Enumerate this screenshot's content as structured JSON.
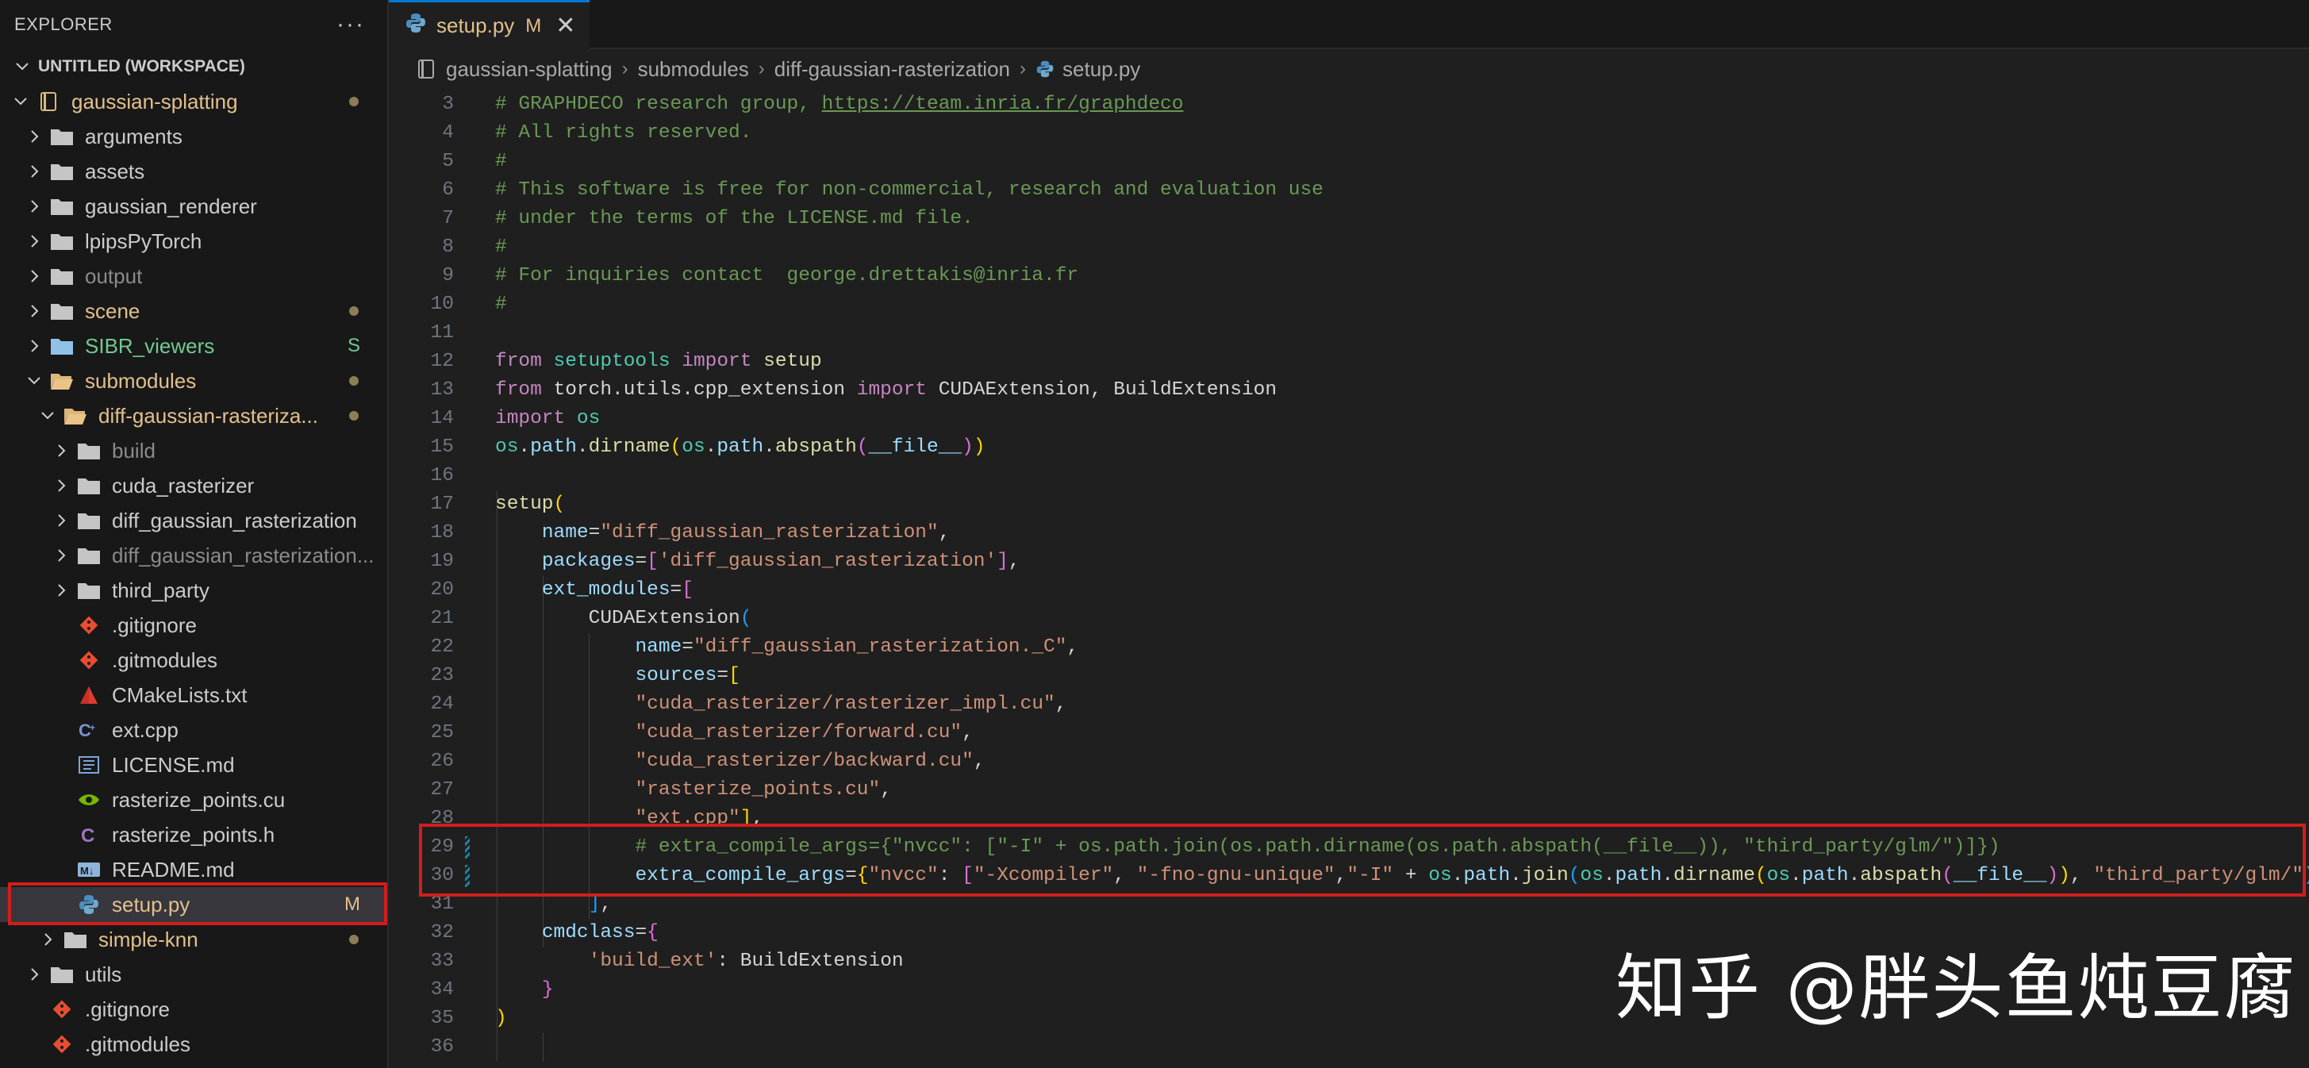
{
  "explorer": {
    "title": "EXPLORER",
    "more_label": "···",
    "workspace": "UNTITLED (WORKSPACE)",
    "items": [
      {
        "label": "gaussian-splatting",
        "type": "repo",
        "open": true,
        "indent": 0,
        "badge": "dot",
        "status": "mod"
      },
      {
        "label": "arguments",
        "type": "folder",
        "open": false,
        "indent": 1
      },
      {
        "label": "assets",
        "type": "folder",
        "open": false,
        "indent": 1
      },
      {
        "label": "gaussian_renderer",
        "type": "folder",
        "open": false,
        "indent": 1
      },
      {
        "label": "lpipsPyTorch",
        "type": "folder",
        "open": false,
        "indent": 1
      },
      {
        "label": "output",
        "type": "folder",
        "open": false,
        "indent": 1,
        "status": "dim"
      },
      {
        "label": "scene",
        "type": "folder",
        "open": false,
        "indent": 1,
        "badge": "dot",
        "status": "mod"
      },
      {
        "label": "SIBR_viewers",
        "type": "folder-blue",
        "open": false,
        "indent": 1,
        "badge": "S",
        "status": "untracked"
      },
      {
        "label": "submodules",
        "type": "folder",
        "open": true,
        "indent": 1,
        "badge": "dot",
        "status": "mod"
      },
      {
        "label": "diff-gaussian-rasteriza...",
        "type": "folder",
        "open": true,
        "indent": 2,
        "badge": "dot",
        "status": "mod"
      },
      {
        "label": "build",
        "type": "folder",
        "open": false,
        "indent": 3,
        "status": "dim"
      },
      {
        "label": "cuda_rasterizer",
        "type": "folder",
        "open": false,
        "indent": 3
      },
      {
        "label": "diff_gaussian_rasterization",
        "type": "folder",
        "open": false,
        "indent": 3
      },
      {
        "label": "diff_gaussian_rasterization...",
        "type": "folder",
        "open": false,
        "indent": 3,
        "status": "dim"
      },
      {
        "label": "third_party",
        "type": "folder",
        "open": false,
        "indent": 3
      },
      {
        "label": ".gitignore",
        "type": "git",
        "indent": 3,
        "nochev": true
      },
      {
        "label": ".gitmodules",
        "type": "git",
        "indent": 3,
        "nochev": true
      },
      {
        "label": "CMakeLists.txt",
        "type": "cmake",
        "indent": 3,
        "nochev": true
      },
      {
        "label": "ext.cpp",
        "type": "cpp",
        "indent": 3,
        "nochev": true
      },
      {
        "label": "LICENSE.md",
        "type": "md",
        "indent": 3,
        "nochev": true
      },
      {
        "label": "rasterize_points.cu",
        "type": "cuda",
        "indent": 3,
        "nochev": true
      },
      {
        "label": "rasterize_points.h",
        "type": "c",
        "indent": 3,
        "nochev": true
      },
      {
        "label": "README.md",
        "type": "readme",
        "indent": 3,
        "nochev": true
      },
      {
        "label": "setup.py",
        "type": "python",
        "indent": 3,
        "nochev": true,
        "badge": "M",
        "status": "mod",
        "selected": true
      },
      {
        "label": "simple-knn",
        "type": "folder",
        "open": false,
        "indent": 2,
        "badge": "dot",
        "status": "mod"
      },
      {
        "label": "utils",
        "type": "folder",
        "open": false,
        "indent": 1
      },
      {
        "label": ".gitignore",
        "type": "git",
        "indent": 1,
        "nochev": true
      },
      {
        "label": ".gitmodules",
        "type": "git",
        "indent": 1,
        "nochev": true
      }
    ]
  },
  "tab": {
    "title": "setup.py",
    "status": "M",
    "close": "✕"
  },
  "breadcrumb": [
    "gaussian-splatting",
    "submodules",
    "diff-gaussian-rasterization",
    "setup.py"
  ],
  "code_lines": [
    {
      "n": "3",
      "toks": [
        [
          "c",
          "# GRAPHDECO research group, "
        ],
        [
          "c u",
          "https://team.inria.fr/graphdeco"
        ]
      ]
    },
    {
      "n": "4",
      "toks": [
        [
          "c",
          "# All rights reserved."
        ]
      ]
    },
    {
      "n": "5",
      "toks": [
        [
          "c",
          "#"
        ]
      ]
    },
    {
      "n": "6",
      "toks": [
        [
          "c",
          "# This software is free for non-commercial, research and evaluation use"
        ]
      ]
    },
    {
      "n": "7",
      "toks": [
        [
          "c",
          "# under the terms of the LICENSE.md file."
        ]
      ]
    },
    {
      "n": "8",
      "toks": [
        [
          "c",
          "#"
        ]
      ]
    },
    {
      "n": "9",
      "toks": [
        [
          "c",
          "# For inquiries contact  george.drettakis@inria.fr"
        ]
      ]
    },
    {
      "n": "10",
      "toks": [
        [
          "c",
          "#"
        ]
      ]
    },
    {
      "n": "11",
      "toks": []
    },
    {
      "n": "12",
      "toks": [
        [
          "k",
          "from "
        ],
        [
          "t",
          "setuptools "
        ],
        [
          "k",
          "import "
        ],
        [
          "f",
          "setup"
        ]
      ]
    },
    {
      "n": "13",
      "toks": [
        [
          "k",
          "from "
        ],
        [
          "p",
          "torch.utils.cpp_extension "
        ],
        [
          "k",
          "import "
        ],
        [
          "p",
          "CUDAExtension, BuildExtension"
        ]
      ]
    },
    {
      "n": "14",
      "toks": [
        [
          "k",
          "import "
        ],
        [
          "t",
          "os"
        ]
      ]
    },
    {
      "n": "15",
      "toks": [
        [
          "t",
          "os"
        ],
        [
          "p",
          "."
        ],
        [
          "v",
          "path"
        ],
        [
          "p",
          "."
        ],
        [
          "f",
          "dirname"
        ],
        [
          "b1",
          "("
        ],
        [
          "t",
          "os"
        ],
        [
          "p",
          "."
        ],
        [
          "v",
          "path"
        ],
        [
          "p",
          "."
        ],
        [
          "f",
          "abspath"
        ],
        [
          "b2",
          "("
        ],
        [
          "v",
          "__file__"
        ],
        [
          "b2",
          ")"
        ],
        [
          "b1",
          ")"
        ]
      ]
    },
    {
      "n": "16",
      "toks": []
    },
    {
      "n": "17",
      "toks": [
        [
          "f",
          "setup"
        ],
        [
          "b1",
          "("
        ]
      ]
    },
    {
      "n": "18",
      "toks": [
        [
          "p",
          "    "
        ],
        [
          "v",
          "name"
        ],
        [
          "p",
          "="
        ],
        [
          "s",
          "\"diff_gaussian_rasterization\""
        ],
        [
          "p",
          ","
        ]
      ]
    },
    {
      "n": "19",
      "toks": [
        [
          "p",
          "    "
        ],
        [
          "v",
          "packages"
        ],
        [
          "p",
          "="
        ],
        [
          "b2",
          "["
        ],
        [
          "s",
          "'diff_gaussian_rasterization'"
        ],
        [
          "b2",
          "]"
        ],
        [
          "p",
          ","
        ]
      ]
    },
    {
      "n": "20",
      "toks": [
        [
          "p",
          "    "
        ],
        [
          "v",
          "ext_modules"
        ],
        [
          "p",
          "="
        ],
        [
          "b2",
          "["
        ]
      ]
    },
    {
      "n": "21",
      "toks": [
        [
          "p",
          "        "
        ],
        [
          "p",
          "CUDAExtension"
        ],
        [
          "b3",
          "("
        ]
      ]
    },
    {
      "n": "22",
      "toks": [
        [
          "p",
          "            "
        ],
        [
          "v",
          "name"
        ],
        [
          "p",
          "="
        ],
        [
          "s",
          "\"diff_gaussian_rasterization._C\""
        ],
        [
          "p",
          ","
        ]
      ]
    },
    {
      "n": "23",
      "toks": [
        [
          "p",
          "            "
        ],
        [
          "v",
          "sources"
        ],
        [
          "p",
          "="
        ],
        [
          "b1",
          "["
        ]
      ]
    },
    {
      "n": "24",
      "toks": [
        [
          "p",
          "            "
        ],
        [
          "s",
          "\"cuda_rasterizer/rasterizer_impl.cu\""
        ],
        [
          "p",
          ","
        ]
      ]
    },
    {
      "n": "25",
      "toks": [
        [
          "p",
          "            "
        ],
        [
          "s",
          "\"cuda_rasterizer/forward.cu\""
        ],
        [
          "p",
          ","
        ]
      ]
    },
    {
      "n": "26",
      "toks": [
        [
          "p",
          "            "
        ],
        [
          "s",
          "\"cuda_rasterizer/backward.cu\""
        ],
        [
          "p",
          ","
        ]
      ]
    },
    {
      "n": "27",
      "toks": [
        [
          "p",
          "            "
        ],
        [
          "s",
          "\"rasterize_points.cu\""
        ],
        [
          "p",
          ","
        ]
      ]
    },
    {
      "n": "28",
      "toks": [
        [
          "p",
          "            "
        ],
        [
          "s",
          "\"ext.cpp\""
        ],
        [
          "b1",
          "]"
        ],
        [
          "p",
          ","
        ]
      ]
    },
    {
      "n": "29",
      "git": true,
      "toks": [
        [
          "p",
          "            "
        ],
        [
          "c",
          "# extra_compile_args={\"nvcc\": [\"-I\" + os.path.join(os.path.dirname(os.path.abspath(__file__)), \"third_party/glm/\")]})"
        ]
      ]
    },
    {
      "n": "30",
      "git": true,
      "toks": [
        [
          "p",
          "            "
        ],
        [
          "v",
          "extra_compile_args"
        ],
        [
          "p",
          "="
        ],
        [
          "b1",
          "{"
        ],
        [
          "s",
          "\"nvcc\""
        ],
        [
          "p",
          ": "
        ],
        [
          "b2",
          "["
        ],
        [
          "s",
          "\"-Xcompiler\""
        ],
        [
          "p",
          ", "
        ],
        [
          "s",
          "\"-fno-gnu-unique\""
        ],
        [
          "p",
          ","
        ],
        [
          "s",
          "\"-I\""
        ],
        [
          "p",
          " + "
        ],
        [
          "t",
          "os"
        ],
        [
          "p",
          "."
        ],
        [
          "v",
          "path"
        ],
        [
          "p",
          "."
        ],
        [
          "f",
          "join"
        ],
        [
          "b3",
          "("
        ],
        [
          "t",
          "os"
        ],
        [
          "p",
          "."
        ],
        [
          "v",
          "path"
        ],
        [
          "p",
          "."
        ],
        [
          "f",
          "dirname"
        ],
        [
          "b1",
          "("
        ],
        [
          "t",
          "os"
        ],
        [
          "p",
          "."
        ],
        [
          "v",
          "path"
        ],
        [
          "p",
          "."
        ],
        [
          "f",
          "abspath"
        ],
        [
          "b2",
          "("
        ],
        [
          "v",
          "__file__"
        ],
        [
          "b2",
          ")"
        ],
        [
          "b1",
          ")"
        ],
        [
          "p",
          ", "
        ],
        [
          "s",
          "\"third_party/glm/\""
        ],
        [
          "b3",
          ")"
        ],
        [
          "b2",
          "]"
        ],
        [
          "b1",
          "}"
        ],
        [
          "b3",
          ")"
        ]
      ]
    },
    {
      "n": "31",
      "toks": [
        [
          "p",
          "        "
        ],
        [
          "b3",
          "]"
        ],
        [
          "p",
          ","
        ]
      ]
    },
    {
      "n": "32",
      "toks": [
        [
          "p",
          "    "
        ],
        [
          "v",
          "cmdclass"
        ],
        [
          "p",
          "="
        ],
        [
          "b2",
          "{"
        ]
      ]
    },
    {
      "n": "33",
      "toks": [
        [
          "p",
          "        "
        ],
        [
          "s",
          "'build_ext'"
        ],
        [
          "p",
          ": BuildExtension"
        ]
      ]
    },
    {
      "n": "34",
      "toks": [
        [
          "p",
          "    "
        ],
        [
          "b2",
          "}"
        ]
      ]
    },
    {
      "n": "35",
      "toks": [
        [
          "b1",
          ")"
        ]
      ]
    },
    {
      "n": "36",
      "toks": []
    }
  ],
  "watermark": "知乎 @胖头鱼炖豆腐",
  "colors": {
    "accent": "#0078d4",
    "highlight_border": "#d21d1d",
    "modified": "#e2c08d",
    "untracked": "#73c991"
  }
}
